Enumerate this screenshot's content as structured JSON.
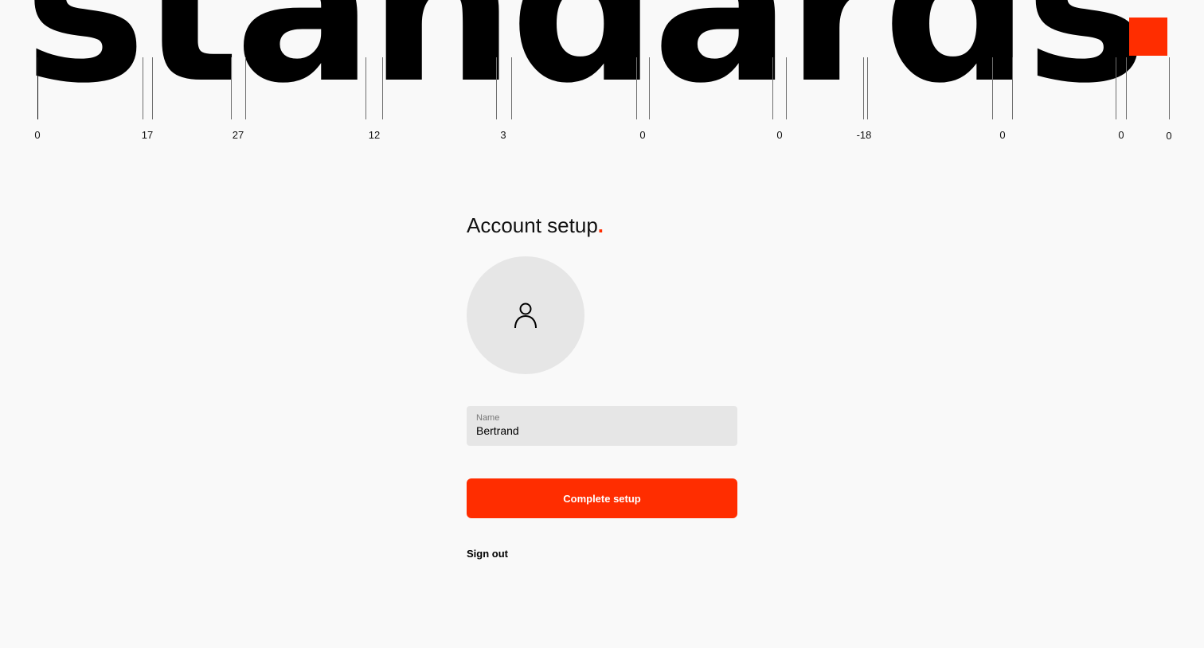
{
  "hero": {
    "word": "standards",
    "accent_color": "#ff2d00"
  },
  "ruler": {
    "labels": [
      "0",
      "17",
      "27",
      "12",
      "3",
      "0",
      "0",
      "-18",
      "0",
      "0",
      "0"
    ]
  },
  "form": {
    "title": "Account setup",
    "title_dot": ".",
    "avatar_icon": "user-icon",
    "name_label": "Name",
    "name_value": "Bertrand",
    "submit_label": "Complete setup",
    "sign_out_label": "Sign out"
  },
  "colors": {
    "accent": "#ff2d00",
    "background": "#f9f9f9",
    "field_bg": "#e6e6e6"
  }
}
